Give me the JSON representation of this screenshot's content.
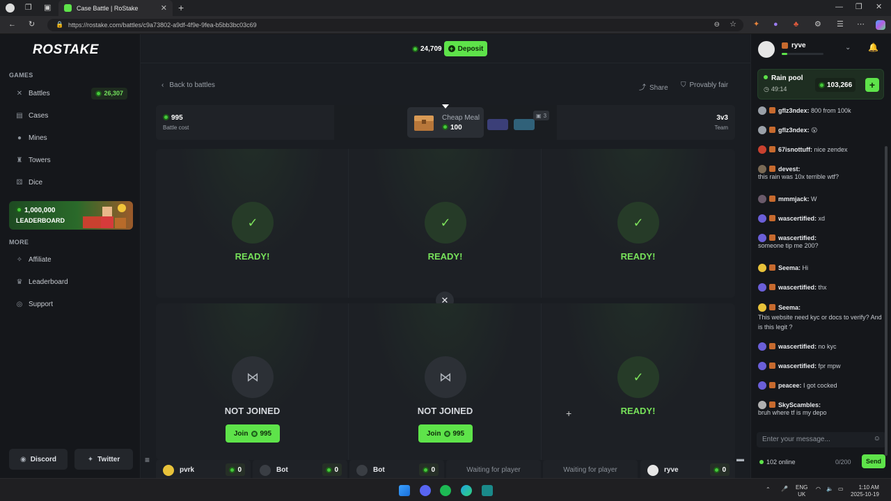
{
  "browser": {
    "tab_title": "Case Battle | RoStake",
    "url": "https://rostake.com/battles/c9a73802-a9df-4f9e-9fea-b5bb3bc03c69",
    "tab_close": "✕",
    "new_tab": "+"
  },
  "sidebar": {
    "logo": "ROSTAKE",
    "games_title": "GAMES",
    "games": [
      {
        "label": "Battles",
        "badge": "26,307"
      },
      {
        "label": "Cases"
      },
      {
        "label": "Mines"
      },
      {
        "label": "Towers"
      },
      {
        "label": "Dice"
      }
    ],
    "leaderboard_card": {
      "amount": "1,000,000",
      "label": "LEADERBOARD"
    },
    "more_title": "MORE",
    "more": [
      {
        "label": "Affiliate"
      },
      {
        "label": "Leaderboard"
      },
      {
        "label": "Support"
      }
    ],
    "discord": "Discord",
    "twitter": "Twitter"
  },
  "header": {
    "balance": "24,709",
    "deposit": "Deposit"
  },
  "battle": {
    "back": "Back to battles",
    "share": "Share",
    "provably_fair": "Provably fair",
    "battle_cost_value": "995",
    "battle_cost_label": "Battle cost",
    "team_value": "3v3",
    "team_label": "Team",
    "case_name": "Cheap Meal",
    "case_price": "100",
    "rounds_count": "3",
    "team1": [
      {
        "status": "READY!"
      },
      {
        "status": "READY!"
      },
      {
        "status": "READY!"
      }
    ],
    "team2": [
      {
        "status": "NOT JOINED",
        "join_label": "Join",
        "join_price": "995"
      },
      {
        "status": "NOT JOINED",
        "join_label": "Join",
        "join_price": "995"
      },
      {
        "status": "READY!"
      }
    ],
    "players": [
      {
        "name": "pvrk",
        "score": "0"
      },
      {
        "name": "Bot",
        "score": "0"
      },
      {
        "name": "Bot",
        "score": "0"
      },
      {
        "waiting": "Waiting for player"
      },
      {
        "waiting": "Waiting for player"
      },
      {
        "name": "ryve",
        "score": "0"
      }
    ]
  },
  "chat": {
    "username": "ryve",
    "rain_title": "Rain pool",
    "rain_timer": "49:14",
    "rain_amount": "103,266",
    "messages": [
      {
        "user": "gflz3ndex:",
        "text": "800 from 100k"
      },
      {
        "user": "gflz3ndex:",
        "text": "😮"
      },
      {
        "user": "67isnottuff:",
        "text": "nice zendex"
      },
      {
        "user": "devest:",
        "text": "this rain was 10x terrible wtf?"
      },
      {
        "user": "mmmjack:",
        "text": "W"
      },
      {
        "user": "wascertified:",
        "text": "xd"
      },
      {
        "user": "wascertified:",
        "text": "someone tip me 200?"
      },
      {
        "user": "Seema:",
        "text": "Hi"
      },
      {
        "user": "wascertified:",
        "text": "thx"
      },
      {
        "user": "Seema:",
        "text": "This website need kyc or docs to verify? And is this legit ?"
      },
      {
        "user": "wascertified:",
        "text": "no kyc"
      },
      {
        "user": "wascertified:",
        "text": "fpr mpw"
      },
      {
        "user": "peacee:",
        "text": "I got cocked"
      },
      {
        "user": "SkyScambles:",
        "text": "bruh where tf is my depo"
      }
    ],
    "input_placeholder": "Enter your message...",
    "online": "102 online",
    "char_count": "0/200",
    "send": "Send"
  },
  "taskbar": {
    "lang": "ENG",
    "region": "UK",
    "time": "1:10 AM",
    "date": "2025-10-19"
  },
  "colors": {
    "accent": "#5ee34a",
    "bg": "#1a1d22",
    "sidebar": "#15171b"
  }
}
